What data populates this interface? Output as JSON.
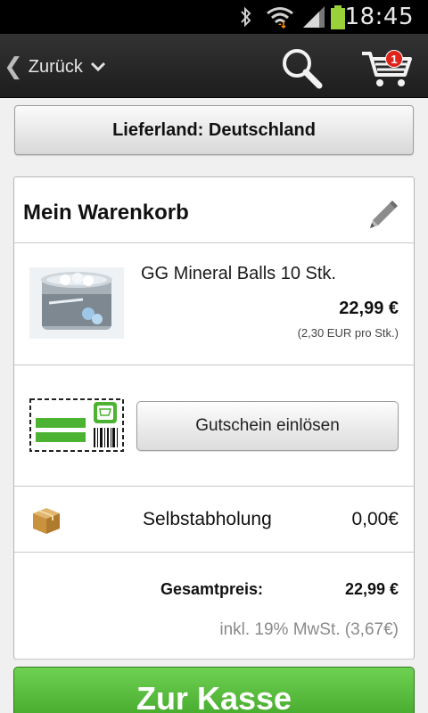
{
  "status_bar": {
    "time": "18:45"
  },
  "header": {
    "back_label": "Zurück",
    "cart_count": "1"
  },
  "country_button": {
    "label": "Lieferland: Deutschland"
  },
  "cart": {
    "title": "Mein Warenkorb",
    "product": {
      "name": "GG Mineral Balls 10 Stk.",
      "price": "22,99 €",
      "unit_price": "(2,30 EUR pro Stk.)",
      "image_label": "GG Mineral Balls"
    },
    "coupon": {
      "button_label": "Gutschein einlösen"
    },
    "shipping": {
      "method": "Selbstabholung",
      "price": "0,00€"
    },
    "total": {
      "label": "Gesamtpreis:",
      "value": "22,99 €",
      "vat_note": "inkl. 19% MwSt. (3,67€)"
    }
  },
  "checkout_button": {
    "label": "Zur Kasse"
  },
  "colors": {
    "accent_green": "#4bb331",
    "badge_red": "#e0241b",
    "header_dark": "#262626"
  }
}
